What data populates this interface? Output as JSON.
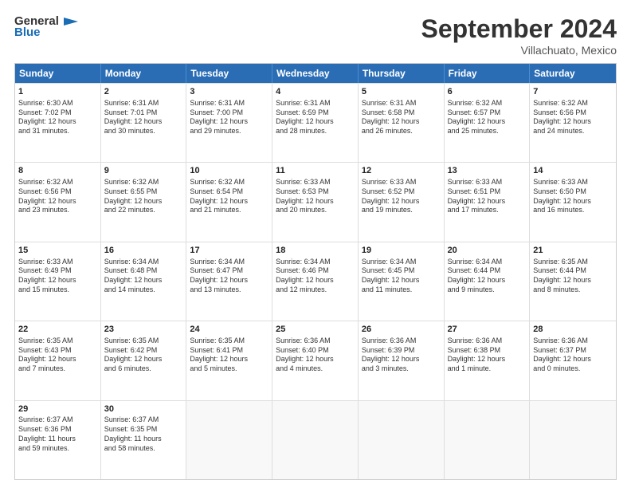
{
  "header": {
    "logo_general": "General",
    "logo_blue": "Blue",
    "title": "September 2024",
    "subtitle": "Villachuato, Mexico"
  },
  "days": [
    "Sunday",
    "Monday",
    "Tuesday",
    "Wednesday",
    "Thursday",
    "Friday",
    "Saturday"
  ],
  "rows": [
    [
      {
        "day": "",
        "data": ""
      },
      {
        "day": "",
        "data": ""
      },
      {
        "day": "",
        "data": ""
      },
      {
        "day": "",
        "data": ""
      },
      {
        "day": "",
        "data": ""
      },
      {
        "day": "",
        "data": ""
      },
      {
        "day": "",
        "data": ""
      }
    ]
  ],
  "cells": [
    [
      {
        "num": "1",
        "lines": [
          "Sunrise: 6:30 AM",
          "Sunset: 7:02 PM",
          "Daylight: 12 hours",
          "and 31 minutes."
        ]
      },
      {
        "num": "2",
        "lines": [
          "Sunrise: 6:31 AM",
          "Sunset: 7:01 PM",
          "Daylight: 12 hours",
          "and 30 minutes."
        ]
      },
      {
        "num": "3",
        "lines": [
          "Sunrise: 6:31 AM",
          "Sunset: 7:00 PM",
          "Daylight: 12 hours",
          "and 29 minutes."
        ]
      },
      {
        "num": "4",
        "lines": [
          "Sunrise: 6:31 AM",
          "Sunset: 6:59 PM",
          "Daylight: 12 hours",
          "and 28 minutes."
        ]
      },
      {
        "num": "5",
        "lines": [
          "Sunrise: 6:31 AM",
          "Sunset: 6:58 PM",
          "Daylight: 12 hours",
          "and 26 minutes."
        ]
      },
      {
        "num": "6",
        "lines": [
          "Sunrise: 6:32 AM",
          "Sunset: 6:57 PM",
          "Daylight: 12 hours",
          "and 25 minutes."
        ]
      },
      {
        "num": "7",
        "lines": [
          "Sunrise: 6:32 AM",
          "Sunset: 6:56 PM",
          "Daylight: 12 hours",
          "and 24 minutes."
        ]
      }
    ],
    [
      {
        "num": "8",
        "lines": [
          "Sunrise: 6:32 AM",
          "Sunset: 6:56 PM",
          "Daylight: 12 hours",
          "and 23 minutes."
        ]
      },
      {
        "num": "9",
        "lines": [
          "Sunrise: 6:32 AM",
          "Sunset: 6:55 PM",
          "Daylight: 12 hours",
          "and 22 minutes."
        ]
      },
      {
        "num": "10",
        "lines": [
          "Sunrise: 6:32 AM",
          "Sunset: 6:54 PM",
          "Daylight: 12 hours",
          "and 21 minutes."
        ]
      },
      {
        "num": "11",
        "lines": [
          "Sunrise: 6:33 AM",
          "Sunset: 6:53 PM",
          "Daylight: 12 hours",
          "and 20 minutes."
        ]
      },
      {
        "num": "12",
        "lines": [
          "Sunrise: 6:33 AM",
          "Sunset: 6:52 PM",
          "Daylight: 12 hours",
          "and 19 minutes."
        ]
      },
      {
        "num": "13",
        "lines": [
          "Sunrise: 6:33 AM",
          "Sunset: 6:51 PM",
          "Daylight: 12 hours",
          "and 17 minutes."
        ]
      },
      {
        "num": "14",
        "lines": [
          "Sunrise: 6:33 AM",
          "Sunset: 6:50 PM",
          "Daylight: 12 hours",
          "and 16 minutes."
        ]
      }
    ],
    [
      {
        "num": "15",
        "lines": [
          "Sunrise: 6:33 AM",
          "Sunset: 6:49 PM",
          "Daylight: 12 hours",
          "and 15 minutes."
        ]
      },
      {
        "num": "16",
        "lines": [
          "Sunrise: 6:34 AM",
          "Sunset: 6:48 PM",
          "Daylight: 12 hours",
          "and 14 minutes."
        ]
      },
      {
        "num": "17",
        "lines": [
          "Sunrise: 6:34 AM",
          "Sunset: 6:47 PM",
          "Daylight: 12 hours",
          "and 13 minutes."
        ]
      },
      {
        "num": "18",
        "lines": [
          "Sunrise: 6:34 AM",
          "Sunset: 6:46 PM",
          "Daylight: 12 hours",
          "and 12 minutes."
        ]
      },
      {
        "num": "19",
        "lines": [
          "Sunrise: 6:34 AM",
          "Sunset: 6:45 PM",
          "Daylight: 12 hours",
          "and 11 minutes."
        ]
      },
      {
        "num": "20",
        "lines": [
          "Sunrise: 6:34 AM",
          "Sunset: 6:44 PM",
          "Daylight: 12 hours",
          "and 9 minutes."
        ]
      },
      {
        "num": "21",
        "lines": [
          "Sunrise: 6:35 AM",
          "Sunset: 6:44 PM",
          "Daylight: 12 hours",
          "and 8 minutes."
        ]
      }
    ],
    [
      {
        "num": "22",
        "lines": [
          "Sunrise: 6:35 AM",
          "Sunset: 6:43 PM",
          "Daylight: 12 hours",
          "and 7 minutes."
        ]
      },
      {
        "num": "23",
        "lines": [
          "Sunrise: 6:35 AM",
          "Sunset: 6:42 PM",
          "Daylight: 12 hours",
          "and 6 minutes."
        ]
      },
      {
        "num": "24",
        "lines": [
          "Sunrise: 6:35 AM",
          "Sunset: 6:41 PM",
          "Daylight: 12 hours",
          "and 5 minutes."
        ]
      },
      {
        "num": "25",
        "lines": [
          "Sunrise: 6:36 AM",
          "Sunset: 6:40 PM",
          "Daylight: 12 hours",
          "and 4 minutes."
        ]
      },
      {
        "num": "26",
        "lines": [
          "Sunrise: 6:36 AM",
          "Sunset: 6:39 PM",
          "Daylight: 12 hours",
          "and 3 minutes."
        ]
      },
      {
        "num": "27",
        "lines": [
          "Sunrise: 6:36 AM",
          "Sunset: 6:38 PM",
          "Daylight: 12 hours",
          "and 1 minute."
        ]
      },
      {
        "num": "28",
        "lines": [
          "Sunrise: 6:36 AM",
          "Sunset: 6:37 PM",
          "Daylight: 12 hours",
          "and 0 minutes."
        ]
      }
    ],
    [
      {
        "num": "29",
        "lines": [
          "Sunrise: 6:37 AM",
          "Sunset: 6:36 PM",
          "Daylight: 11 hours",
          "and 59 minutes."
        ]
      },
      {
        "num": "30",
        "lines": [
          "Sunrise: 6:37 AM",
          "Sunset: 6:35 PM",
          "Daylight: 11 hours",
          "and 58 minutes."
        ]
      },
      {
        "num": "",
        "lines": []
      },
      {
        "num": "",
        "lines": []
      },
      {
        "num": "",
        "lines": []
      },
      {
        "num": "",
        "lines": []
      },
      {
        "num": "",
        "lines": []
      }
    ]
  ]
}
